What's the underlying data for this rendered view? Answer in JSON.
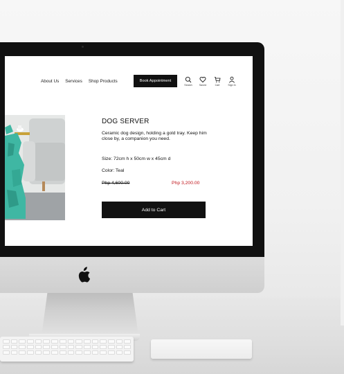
{
  "nav": {
    "links": [
      "About Us",
      "Services",
      "Shop Products"
    ],
    "book_label": "Book Appointment",
    "icons": [
      {
        "icon": "search-icon",
        "label": "Search"
      },
      {
        "icon": "heart-icon",
        "label": "Saved"
      },
      {
        "icon": "cart-icon",
        "label": "Cart"
      },
      {
        "icon": "user-icon",
        "label": "Sign In"
      }
    ]
  },
  "product": {
    "title": "DOG SERVER",
    "description": "Ceramic dog design, holding a gold tray. Keep him close by, a companion you need.",
    "size": "Size: 72cm h x 50cm w x 45cm d",
    "color": "Color: Teal",
    "old_price": "Php 4,600.00",
    "new_price": "Php 3,200.00",
    "cart_label": "Add to Cart"
  },
  "colors": {
    "accent": "#111111",
    "sale": "#c0151b",
    "teal": "#3fb7a3"
  }
}
